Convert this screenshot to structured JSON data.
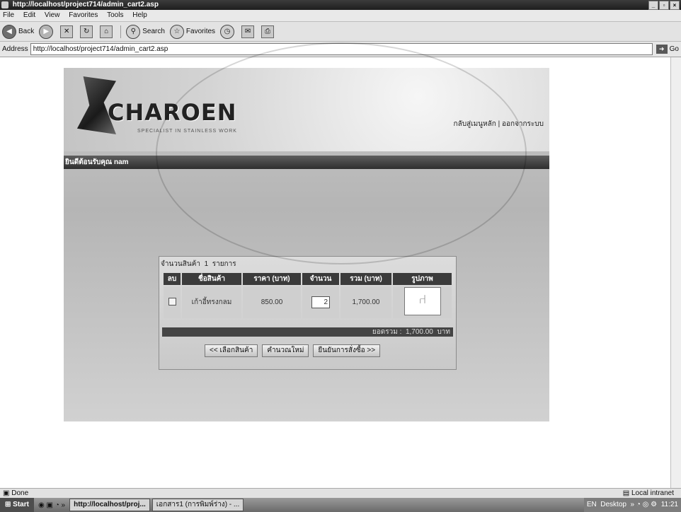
{
  "window": {
    "title": "http://localhost/project714/admin_cart2.asp"
  },
  "menu": [
    "File",
    "Edit",
    "View",
    "Favorites",
    "Tools",
    "Help"
  ],
  "toolbar": {
    "back": "Back",
    "search": "Search",
    "favorites": "Favorites"
  },
  "address": {
    "label": "Address",
    "url": "http://localhost/project714/admin_cart2.asp",
    "go": "Go"
  },
  "site": {
    "logo": "CHAROEN",
    "tagline": "SPECIALIST IN STAINLESS WORK",
    "links": {
      "home": "กลับสู่เมนูหลัก",
      "sep": "|",
      "logout": "ออกจากระบบ"
    },
    "welcome": "ยินดีต้อนรับคุณ nam"
  },
  "cart": {
    "count_label": "จำนวนสินค้า",
    "count": "1",
    "count_unit": "รายการ",
    "headers": [
      "ลบ",
      "ชื่อสินค้า",
      "ราคา (บาท)",
      "จำนวน",
      "รวม (บาท)",
      "รูปภาพ"
    ],
    "items": [
      {
        "name": "เก้าอี้ทรงกลม",
        "price": "850.00",
        "qty": "2",
        "total": "1,700.00"
      }
    ],
    "grand_total_label": "ยอดรวม :",
    "grand_total": "1,700.00",
    "grand_total_unit": "บาท",
    "buttons": {
      "continue": "<< เลือกสินค้า",
      "recalc": "คำนวณใหม่",
      "confirm": "ยืนยันการสั่งซื้อ >>"
    }
  },
  "status": {
    "left": "Done",
    "zone": "Local intranet"
  },
  "taskbar": {
    "start": "Start",
    "tasks": [
      "http://localhost/proj...",
      "เอกสาร1 (การพิมพ์ร่าง) - ..."
    ],
    "tray": "Desktop",
    "clock": "11:21"
  }
}
